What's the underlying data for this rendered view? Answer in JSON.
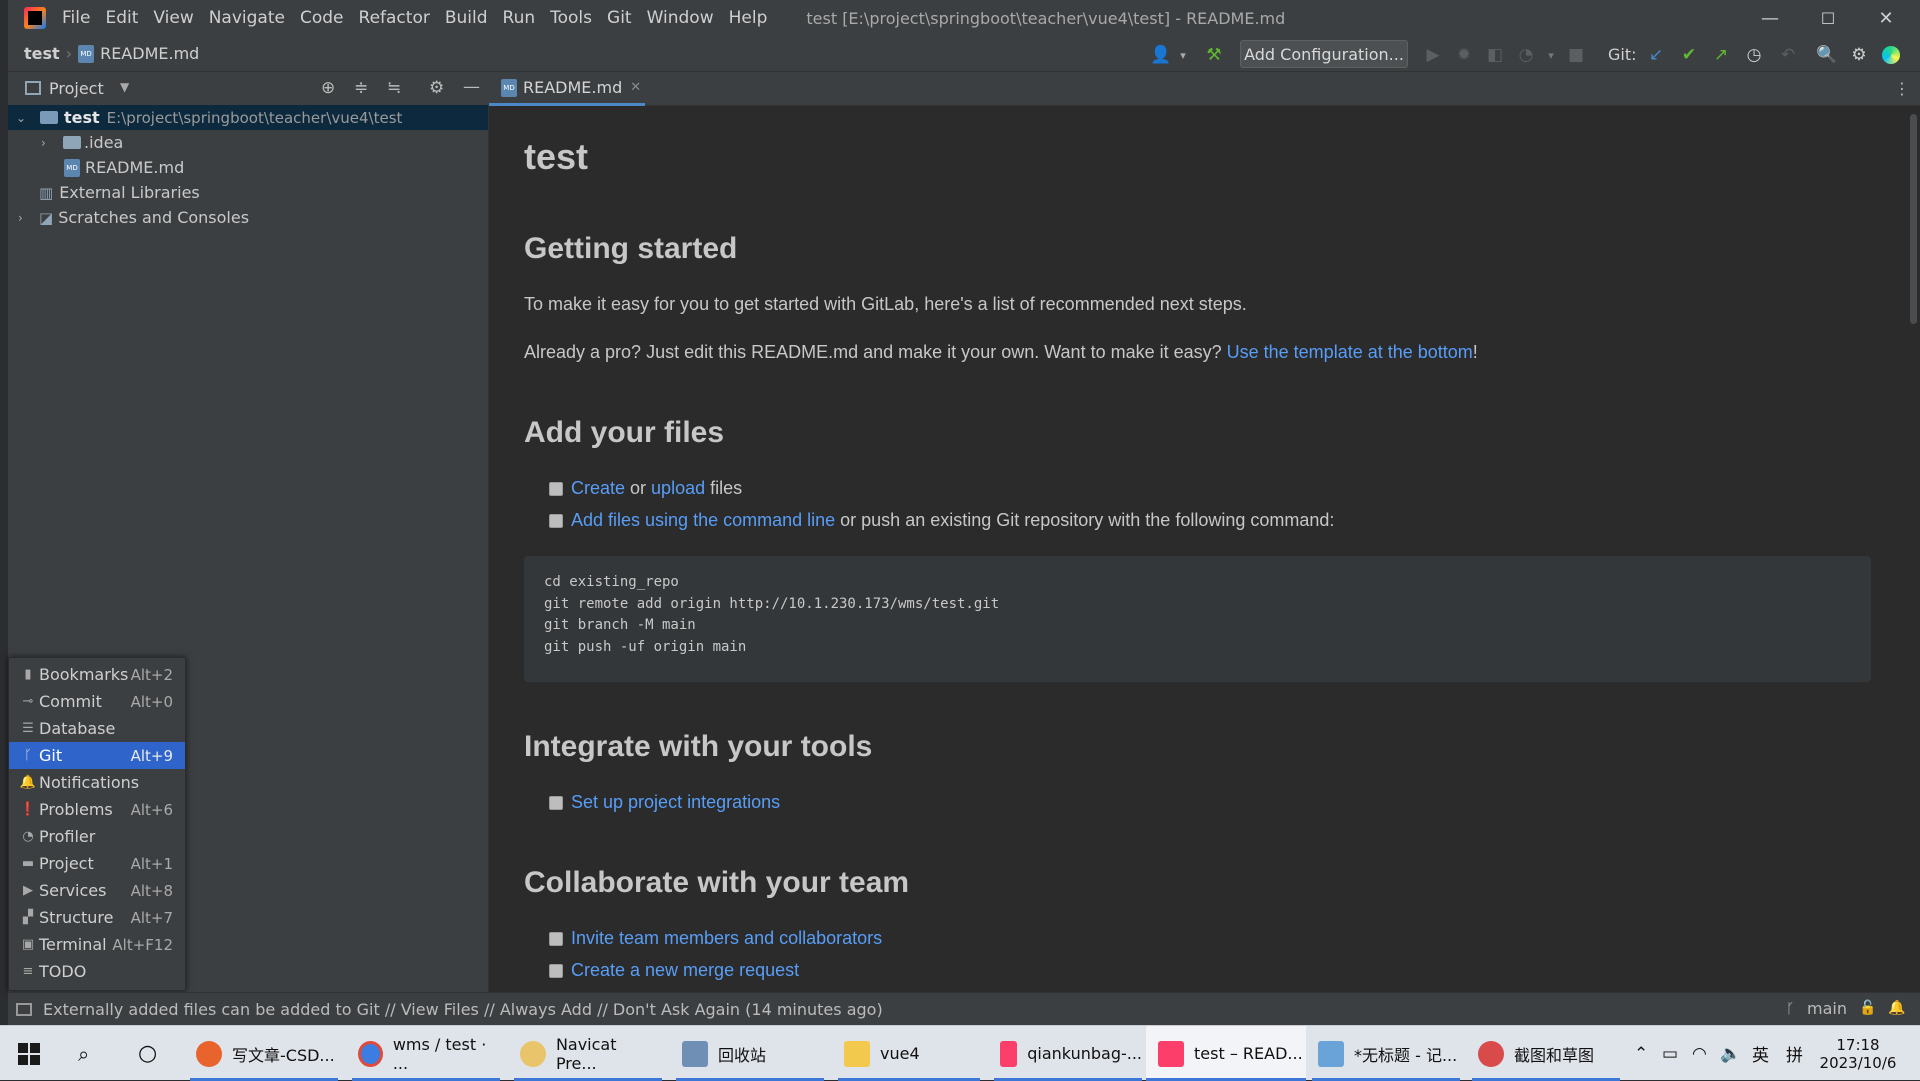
{
  "window": {
    "menu": [
      "File",
      "Edit",
      "View",
      "Navigate",
      "Code",
      "Refactor",
      "Build",
      "Run",
      "Tools",
      "Git",
      "Window",
      "Help"
    ],
    "title": "test [E:\\project\\springboot\\teacher\\vue4\\test] - README.md",
    "min": "—",
    "max": "☐",
    "close": "✕"
  },
  "nav": {
    "crumb_project": "test",
    "crumb_file": "README.md",
    "add_config": "Add Configuration...",
    "git_label": "Git:"
  },
  "project": {
    "header": "Project",
    "tree": [
      {
        "label": "test",
        "path": "E:\\project\\springboot\\teacher\\vue4\\test"
      },
      {
        "label": ".idea"
      },
      {
        "label": "README.md"
      },
      {
        "label": "External Libraries"
      },
      {
        "label": "Scratches and Consoles"
      }
    ]
  },
  "editor": {
    "tab": "README.md",
    "h1": "test",
    "sections": [
      {
        "title": "Getting started"
      },
      {
        "title": "Add your files"
      },
      {
        "title": "Integrate with your tools"
      },
      {
        "title": "Collaborate with your team"
      }
    ],
    "p1": "To make it easy for you to get started with GitLab, here's a list of recommended next steps.",
    "p2_pre": "Already a pro? Just edit this README.md and make it your own. Want to make it easy? ",
    "p2_link": "Use the template at the bottom",
    "p2_post": "!",
    "files_1_link1": "Create",
    "files_1_mid": " or ",
    "files_1_link2": "upload",
    "files_1_post": " files",
    "files_2_link": "Add files using the command line",
    "files_2_post": " or push an existing Git repository with the following command:",
    "code": [
      "cd existing_repo",
      "git remote add origin http://10.1.230.173/wms/test.git",
      "git branch -M main",
      "git push -uf origin main"
    ],
    "tools_1": "Set up project integrations",
    "team_1": "Invite team members and collaborators",
    "team_2": "Create a new merge request"
  },
  "toolwindows": [
    {
      "label": "Bookmarks",
      "shortcut": "Alt+2",
      "icon": "bookmark-icon"
    },
    {
      "label": "Commit",
      "shortcut": "Alt+0",
      "icon": "commit-icon"
    },
    {
      "label": "Database",
      "shortcut": "",
      "icon": "database-icon"
    },
    {
      "label": "Git",
      "shortcut": "Alt+9",
      "icon": "git-branch-icon",
      "selected": true
    },
    {
      "label": "Notifications",
      "shortcut": "",
      "icon": "bell-icon"
    },
    {
      "label": "Problems",
      "shortcut": "Alt+6",
      "icon": "problems-icon"
    },
    {
      "label": "Profiler",
      "shortcut": "",
      "icon": "profiler-icon"
    },
    {
      "label": "Project",
      "shortcut": "Alt+1",
      "icon": "folder-icon"
    },
    {
      "label": "Services",
      "shortcut": "Alt+8",
      "icon": "services-icon"
    },
    {
      "label": "Structure",
      "shortcut": "Alt+7",
      "icon": "structure-icon"
    },
    {
      "label": "Terminal",
      "shortcut": "Alt+F12",
      "icon": "terminal-icon"
    },
    {
      "label": "TODO",
      "shortcut": "",
      "icon": "todo-icon"
    }
  ],
  "status": {
    "message": "Externally added files can be added to Git // View Files // Always Add // Don't Ask Again (14 minutes ago)",
    "branch": "main"
  },
  "taskbar": {
    "items": [
      {
        "label": "写文章-CSD...",
        "color": "#e8642c"
      },
      {
        "label": "wms / test · ...",
        "color": "#3b7de0"
      },
      {
        "label": "Navicat Pre...",
        "color": "#e9c46a"
      },
      {
        "label": "回收站",
        "color": "#6f8fb5"
      },
      {
        "label": "vue4",
        "color": "#f2c94c"
      },
      {
        "label": "qiankunbag-...",
        "color": "#fc3e6a"
      },
      {
        "label": "test – READ...",
        "color": "#fc3e6a"
      },
      {
        "label": "*无标题 - 记...",
        "color": "#6aa3d8"
      },
      {
        "label": "截图和草图",
        "color": "#d94b4b"
      }
    ],
    "ime": "英",
    "ime2": "拼",
    "time": "17:18",
    "date": "2023/10/6"
  }
}
